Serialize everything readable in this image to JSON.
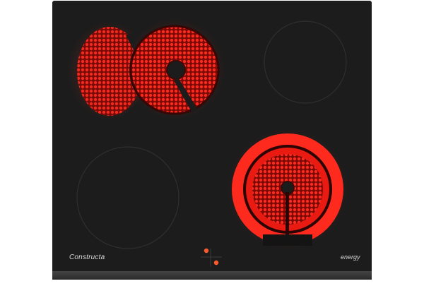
{
  "cooktop": {
    "brand": "Constructa",
    "energy_label": "energy",
    "top_left_marking": "",
    "top_right_marking": [
      "",
      "",
      ""
    ],
    "colors": {
      "glass": "#1c1c1c",
      "frame": "#3a3a3a",
      "heat_red": "#ff2a1e",
      "heat_dark": "#7a0a06",
      "zone_outline": "#2f2f2f",
      "control_dot": "#ff5a2a",
      "text": "#d9d9d9"
    },
    "zones": [
      {
        "name": "rear-left dual oval zone",
        "state": "on"
      },
      {
        "name": "rear-right zone",
        "state": "off"
      },
      {
        "name": "front-left zone",
        "state": "off"
      },
      {
        "name": "front-right dual circuit zone",
        "state": "on"
      }
    ],
    "controls": {
      "indicators_lit": 2
    }
  }
}
